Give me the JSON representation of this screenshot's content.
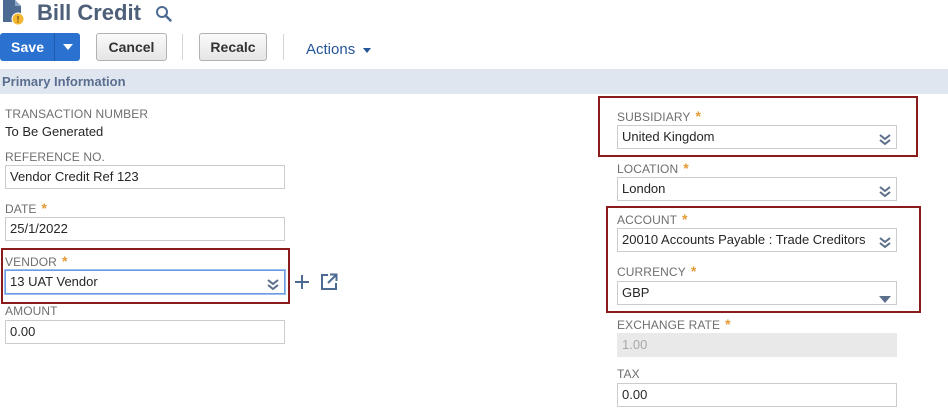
{
  "header": {
    "title": "Bill Credit",
    "page_icon": "bill-document-icon",
    "search_icon": "search-icon"
  },
  "toolbar": {
    "save_label": "Save",
    "cancel_label": "Cancel",
    "recalc_label": "Recalc",
    "actions_label": "Actions"
  },
  "section": {
    "title": "Primary Information"
  },
  "fields": {
    "transaction_number": {
      "label": "TRANSACTION NUMBER",
      "value": "To Be Generated"
    },
    "reference_no": {
      "label": "REFERENCE NO.",
      "value": "Vendor Credit Ref 123"
    },
    "date": {
      "label": "DATE",
      "value": "25/1/2022",
      "required": "*"
    },
    "vendor": {
      "label": "VENDOR",
      "value": "13 UAT Vendor",
      "required": "*"
    },
    "amount": {
      "label": "AMOUNT",
      "value": "0.00"
    },
    "subsidiary": {
      "label": "SUBSIDIARY",
      "value": "United Kingdom",
      "required": "*"
    },
    "location": {
      "label": "LOCATION",
      "value": "London",
      "required": "*"
    },
    "account": {
      "label": "ACCOUNT",
      "value": "20010 Accounts Payable : Trade Creditors",
      "required": "*"
    },
    "currency": {
      "label": "CURRENCY",
      "value": "GBP",
      "required": "*"
    },
    "exchange_rate": {
      "label": "EXCHANGE RATE",
      "value": "1.00",
      "required": "*"
    },
    "tax": {
      "label": "TAX",
      "value": "0.00"
    }
  },
  "colors": {
    "accent": "#2a71d0",
    "title": "#4d5f79",
    "required": "#e39b35",
    "highlight": "#8a1b1b",
    "section_bg": "#e0e6ef"
  }
}
